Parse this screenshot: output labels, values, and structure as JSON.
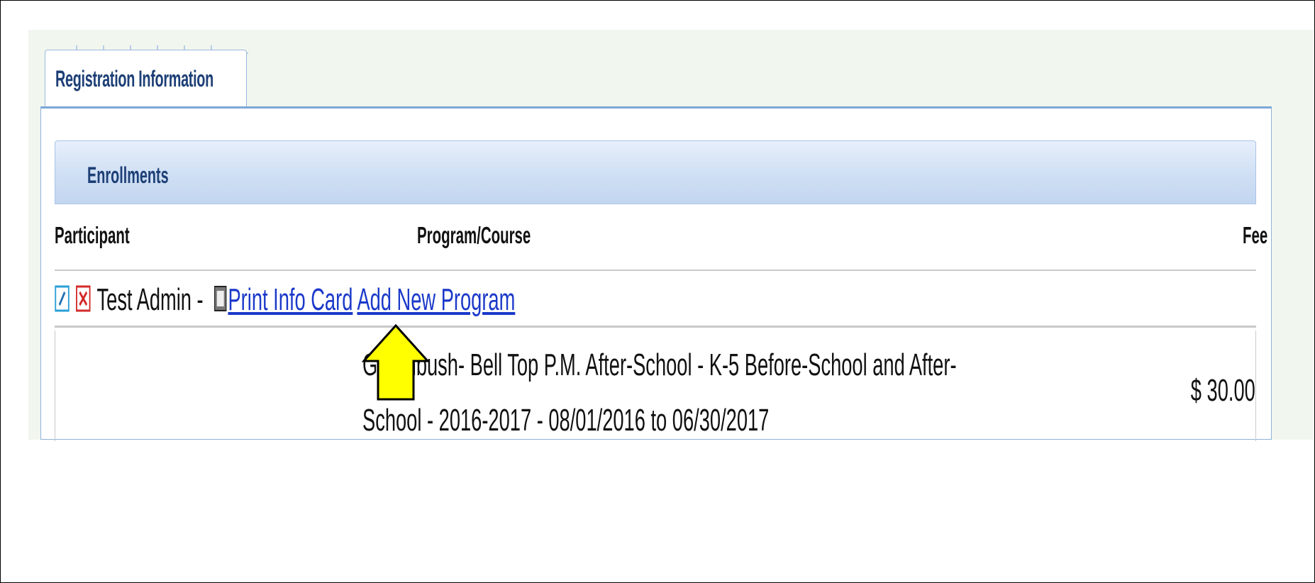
{
  "tabs": [
    {
      "label": "Registration Information",
      "active": true
    }
  ],
  "section": {
    "title": "Enrollments"
  },
  "columns": {
    "participant": "Participant",
    "program": "Program/Course",
    "fee": "Fee"
  },
  "participant_row": {
    "name": "Test Admin -",
    "print_link": "Print Info Card",
    "add_link": "Add New Program"
  },
  "enrollment": {
    "course_line1": "Greenbush- Bell Top P.M. After-School - K-5 Before-School and After-",
    "course_line2": "School - 2016-2017 - 08/01/2016 to 06/30/2017",
    "fee": "$ 30.00"
  },
  "icons": {
    "edit": "edit-icon",
    "delete": "delete-icon",
    "print": "print-icon",
    "pointer": "yellow-arrow"
  },
  "colors": {
    "link": "#1b39c9",
    "header_text": "#1d3f76",
    "highlight_arrow": "#ffff00"
  }
}
